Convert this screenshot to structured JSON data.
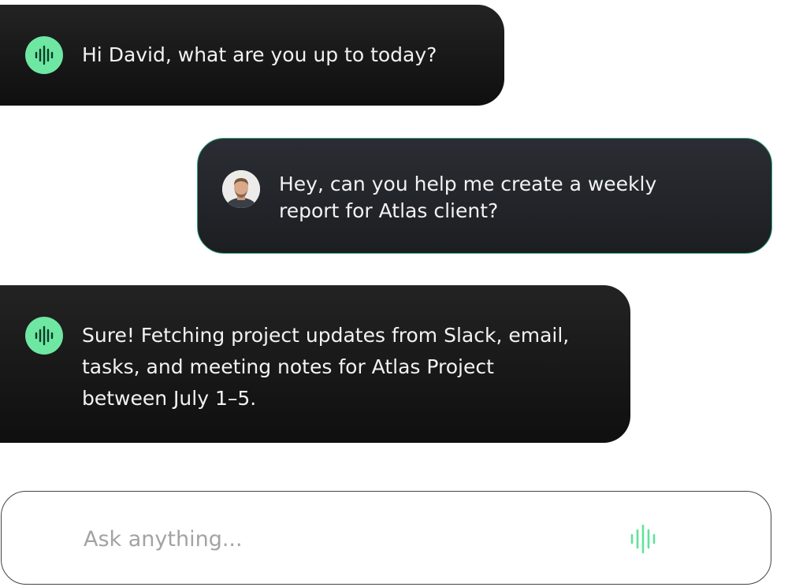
{
  "colors": {
    "accent_green": "#6ee7a3",
    "bubble_dark": "#151515",
    "user_bubble": "#24272c",
    "user_border": "#2fa37c",
    "placeholder": "#a3a3a3"
  },
  "messages": [
    {
      "sender": "assistant",
      "icon": "soundwave-icon",
      "text": "Hi David, what are you up to today?"
    },
    {
      "sender": "user",
      "icon": "user-avatar",
      "text": "Hey, can you help me create a weekly report for Atlas client?"
    },
    {
      "sender": "assistant",
      "icon": "soundwave-icon",
      "text": "Sure! Fetching project updates from Slack, email, tasks, and meeting notes for Atlas Project between July 1–5."
    }
  ],
  "composer": {
    "placeholder": "Ask anything...",
    "value": "",
    "voice_icon": "soundwave-icon"
  }
}
